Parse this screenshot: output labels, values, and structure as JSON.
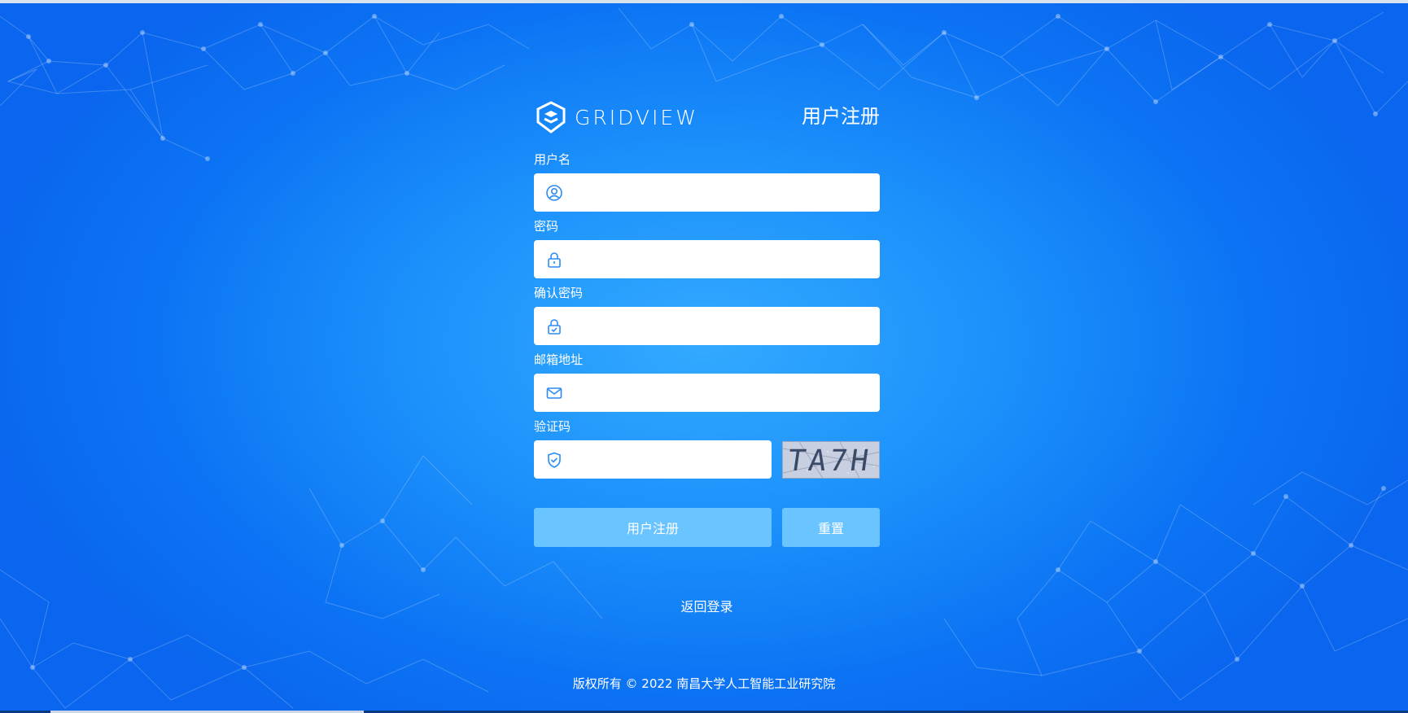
{
  "header": {
    "logo_text": "GRIDVIEW",
    "title": "用户注册"
  },
  "form": {
    "username": {
      "label": "用户名",
      "value": "",
      "icon": "user-icon"
    },
    "password": {
      "label": "密码",
      "value": "",
      "icon": "lock-icon"
    },
    "confirm_password": {
      "label": "确认密码",
      "value": "",
      "icon": "lock-check-icon"
    },
    "email": {
      "label": "邮箱地址",
      "value": "",
      "icon": "mail-icon"
    },
    "captcha": {
      "label": "验证码",
      "value": "",
      "icon": "shield-icon",
      "image_text": "TA7H"
    }
  },
  "buttons": {
    "register_label": "用户注册",
    "reset_label": "重置"
  },
  "back_link_label": "返回登录",
  "footer": {
    "copyright": "版权所有 © 2022 南昌大学人工智能工业研究院"
  },
  "colors": {
    "background": "#1c91fb",
    "button": "#69c4ff",
    "icon": "#2d8cf0"
  }
}
